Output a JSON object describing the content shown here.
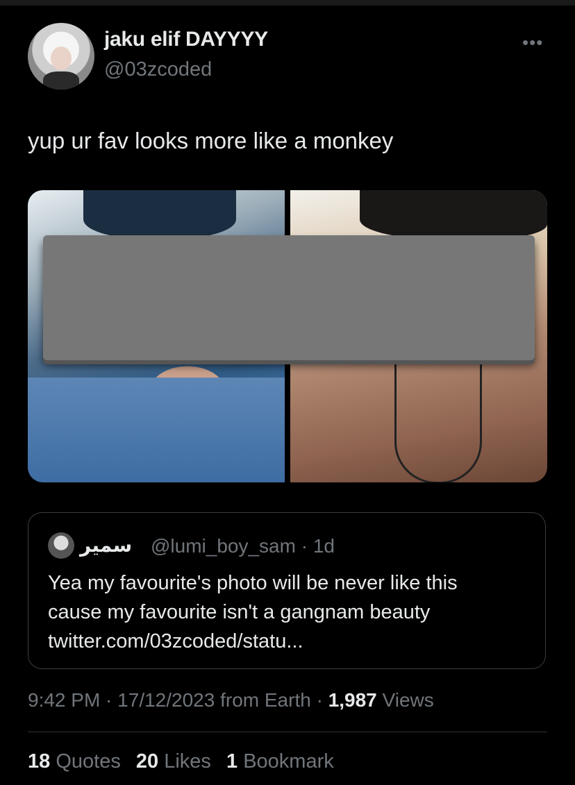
{
  "author": {
    "display_name": "jaku elif DAYYYY",
    "handle": "@03zcoded"
  },
  "more_icon": "more-horizontal-icon",
  "tweet": {
    "text": "yup ur fav looks more like a monkey"
  },
  "quoted_tweet": {
    "display_name": "سمير",
    "handle_time": "@lumi_boy_sam · 1d",
    "text_line1": "Yea my favourite's photo will be never like this",
    "text_line2": "cause my favourite isn't a gangnam beauty",
    "text_line3": "twitter.com/03zcoded/statu..."
  },
  "meta": {
    "time": "9:42 PM",
    "date": "17/12/2023",
    "source": "from Earth",
    "views_count": "1,987",
    "views_label": "Views"
  },
  "stats": {
    "quotes_count": "18",
    "quotes_label": "Quotes",
    "likes_count": "20",
    "likes_label": "Likes",
    "bookmarks_count": "1",
    "bookmarks_label": "Bookmark"
  },
  "colors": {
    "background": "#000000",
    "text_primary": "#e7e9ea",
    "text_secondary": "#71767b",
    "border": "#2f3336"
  }
}
